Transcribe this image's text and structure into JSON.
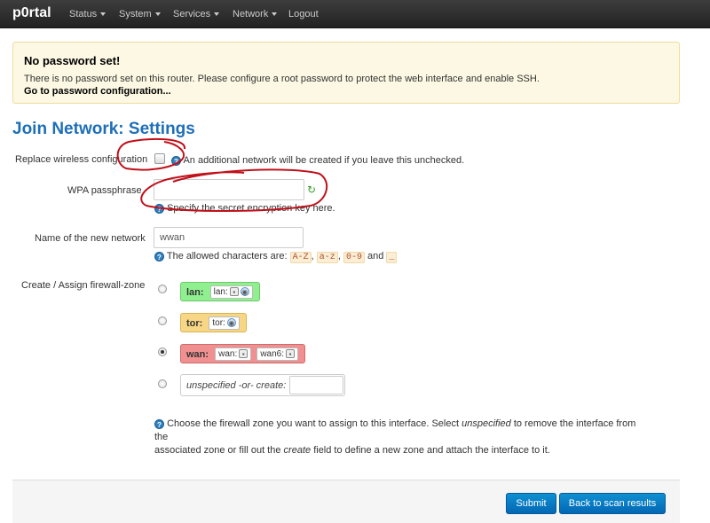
{
  "nav": {
    "brand": "p0rtal",
    "items": [
      "Status",
      "System",
      "Services",
      "Network",
      "Logout"
    ]
  },
  "alert": {
    "title": "No password set!",
    "text": "There is no password set on this router. Please configure a root password to protect the web interface and enable SSH.",
    "link": "Go to password configuration..."
  },
  "page_title": "Join Network: Settings",
  "fields": {
    "replace_label": "Replace wireless configuration",
    "replace_help": "An additional network will be created if you leave this unchecked.",
    "wpa_label": "WPA passphrase",
    "wpa_value": "",
    "wpa_help": "Specify the secret encryption key here.",
    "name_label": "Name of the new network",
    "name_value": "wwan",
    "name_help_prefix": "The allowed characters are:",
    "name_help_chars": [
      "A-Z",
      "a-z",
      "0-9",
      "_"
    ],
    "name_help_sep1": ",",
    "name_help_sep2": ",",
    "name_help_and": "and",
    "firewall_label": "Create / Assign firewall-zone"
  },
  "zones": {
    "lan": {
      "name": "lan:",
      "ifaces": [
        "lan:"
      ],
      "color": "#90f090"
    },
    "tor": {
      "name": "tor:",
      "ifaces": [
        "tor:"
      ],
      "color": "#f7d785"
    },
    "wan": {
      "name": "wan:",
      "ifaces": [
        "wan:",
        "wan6:"
      ],
      "color": "#f09090",
      "selected": true
    },
    "unspecified_label": "unspecified -or- create:"
  },
  "firewall_help": {
    "line1_a": "Choose the firewall zone you want to assign to this interface. Select",
    "line1_em": "unspecified",
    "line1_b": "to remove the interface from the",
    "line2_a": "associated zone or fill out the",
    "line2_em": "create",
    "line2_b": "field to define a new zone and attach the interface to it."
  },
  "buttons": {
    "submit": "Submit",
    "back": "Back to scan results"
  },
  "colors": {
    "accent": "#1e6fb8",
    "button": "#0675c4",
    "annotation": "#c0101a"
  }
}
